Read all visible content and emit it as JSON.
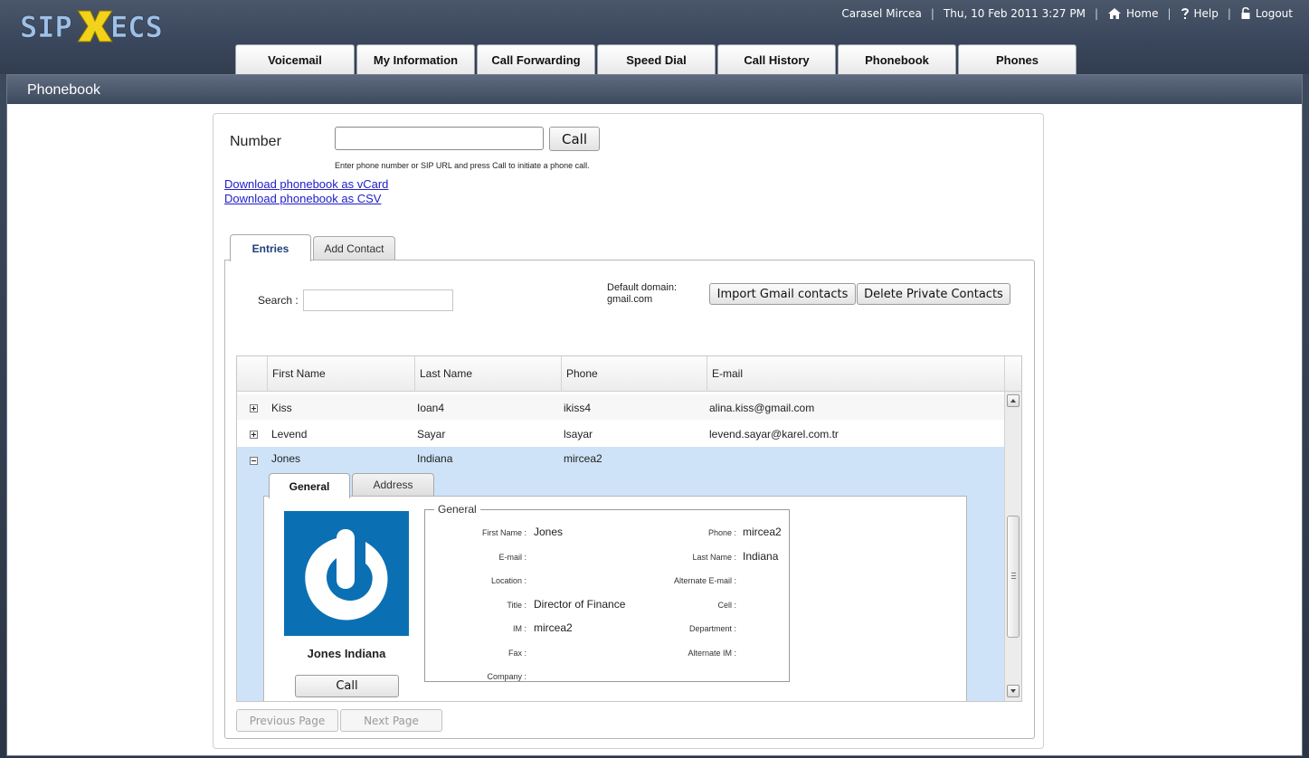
{
  "brand": {
    "logo_text": "SIPXECS"
  },
  "header": {
    "user": "Carasel Mircea",
    "datetime": "Thu, 10 Feb 2011 3:27 PM",
    "home_label": "Home",
    "help_label": "Help",
    "logout_label": "Logout"
  },
  "main_tabs": [
    {
      "label": "Voicemail"
    },
    {
      "label": "My Information"
    },
    {
      "label": "Call Forwarding"
    },
    {
      "label": "Speed Dial"
    },
    {
      "label": "Call History"
    },
    {
      "label": "Phonebook"
    },
    {
      "label": "Phones"
    }
  ],
  "page": {
    "title": "Phonebook"
  },
  "dialer": {
    "number_label": "Number",
    "number_value": "",
    "call_label": "Call",
    "hint": "Enter phone number or SIP URL and press Call to initiate a phone call."
  },
  "downloads": {
    "vcard": "Download phonebook as vCard",
    "csv": "Download phonebook as CSV"
  },
  "sub_tabs": {
    "entries": "Entries",
    "add_contact": "Add Contact"
  },
  "entries": {
    "search_label": "Search :",
    "search_value": "",
    "domain_label": "Default domain:",
    "domain_value": "gmail.com",
    "import_gmail": "Import Gmail contacts",
    "delete_private": "Delete Private Contacts"
  },
  "table": {
    "columns": [
      "First Name",
      "Last Name",
      "Phone",
      "E-mail"
    ],
    "rows": [
      {
        "first": "Kiss",
        "last": "Ioan4",
        "phone": "ikiss4",
        "email": "alina.kiss@gmail.com",
        "expanded": false
      },
      {
        "first": "Levend",
        "last": "Sayar",
        "phone": "lsayar",
        "email": "levend.sayar@karel.com.tr",
        "expanded": false
      },
      {
        "first": "Jones",
        "last": "Indiana",
        "phone": "mircea2",
        "email": "",
        "expanded": true
      }
    ]
  },
  "detail": {
    "tabs": {
      "general": "General",
      "address": "Address"
    },
    "fullname": "Jones Indiana",
    "call_label": "Call",
    "legend": "General",
    "fields": {
      "first_name": {
        "label": "First Name :",
        "value": "Jones"
      },
      "email": {
        "label": "E-mail :",
        "value": ""
      },
      "location": {
        "label": "Location :",
        "value": ""
      },
      "title": {
        "label": "Title :",
        "value": "Director of Finance"
      },
      "im": {
        "label": "IM :",
        "value": "mircea2"
      },
      "fax": {
        "label": "Fax :",
        "value": ""
      },
      "company": {
        "label": "Company :",
        "value": ""
      },
      "phone": {
        "label": "Phone :",
        "value": "mircea2"
      },
      "last_name": {
        "label": "Last Name :",
        "value": "Indiana"
      },
      "alt_email": {
        "label": "Alternate E-mail :",
        "value": ""
      },
      "cell": {
        "label": "Cell :",
        "value": ""
      },
      "department": {
        "label": "Department :",
        "value": ""
      },
      "alt_im": {
        "label": "Alternate IM :",
        "value": ""
      }
    }
  },
  "pagination": {
    "previous": "Previous Page",
    "next": "Next Page"
  },
  "colors": {
    "header_bg": "#3e4b5e",
    "link": "#2020c8",
    "selected_row": "#cfe3f8",
    "avatar_bg": "#0b6fb3",
    "logo_yellow": "#f2d21b",
    "logo_blue": "#9fc0e6"
  }
}
